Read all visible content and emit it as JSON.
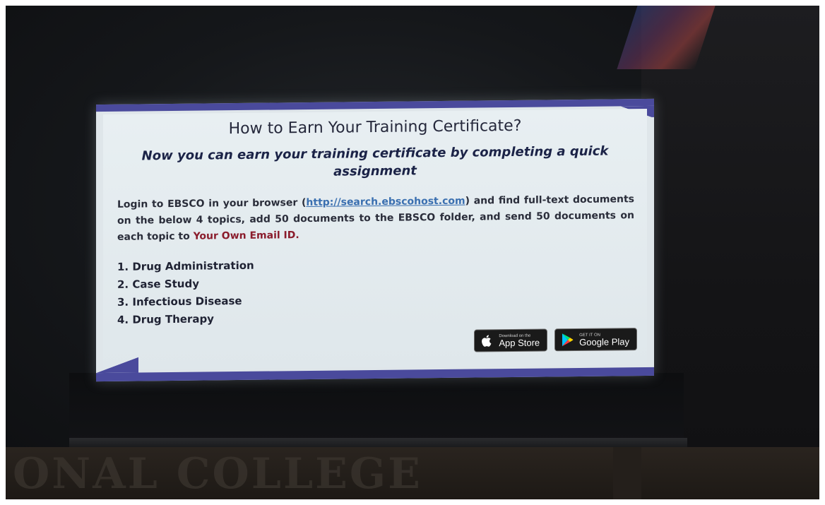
{
  "slide": {
    "title": "How to Earn Your Training Certificate?",
    "subtitle": "Now you can earn your training certificate by completing a quick assignment",
    "body_before_link": "Login to EBSCO in your browser (",
    "link_text": "http://search.ebscohost.com",
    "body_after_link": ") and find full-text documents on the below 4 topics, add 50 documents to the EBSCO folder, and send 50 documents on each topic to ",
    "email_text": "Your Own Email ID.",
    "topics": [
      "1. Drug Administration",
      "2. Case Study",
      "3. Infectious Disease",
      "4. Drug Therapy"
    ],
    "badges": {
      "app_store_small": "Download on the",
      "app_store_label": "App Store",
      "google_play_small": "GET IT ON",
      "google_play_label": "Google Play"
    },
    "colors": {
      "border": "#4a4a9c",
      "email": "#8a1c2c",
      "link": "#3a6fb0"
    }
  },
  "background": {
    "sign_text": "ONAL COLLEGE"
  },
  "icons": [
    "apple-icon",
    "google-play-icon"
  ]
}
